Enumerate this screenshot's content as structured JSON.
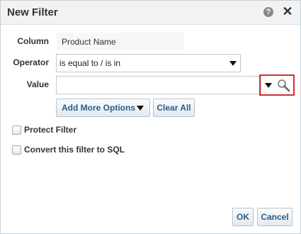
{
  "dialog": {
    "title": "New Filter",
    "help_icon": "?",
    "close_icon": "✕"
  },
  "form": {
    "column_label": "Column",
    "column_value": "Product Name",
    "operator_label": "Operator",
    "operator_value": "is equal to / is in",
    "value_label": "Value",
    "value_value": ""
  },
  "buttons": {
    "add_more_options": "Add More Options",
    "clear_all": "Clear All",
    "ok": "OK",
    "cancel": "Cancel"
  },
  "checkboxes": {
    "protect_filter": "Protect Filter",
    "protect_filter_checked": false,
    "convert_to_sql": "Convert this filter to SQL",
    "convert_to_sql_checked": false
  },
  "colors": {
    "button_text": "#2b5c8a",
    "highlight": "#d43030"
  },
  "icons": {
    "search": "search-icon",
    "dropdown": "chevron-down-icon"
  }
}
